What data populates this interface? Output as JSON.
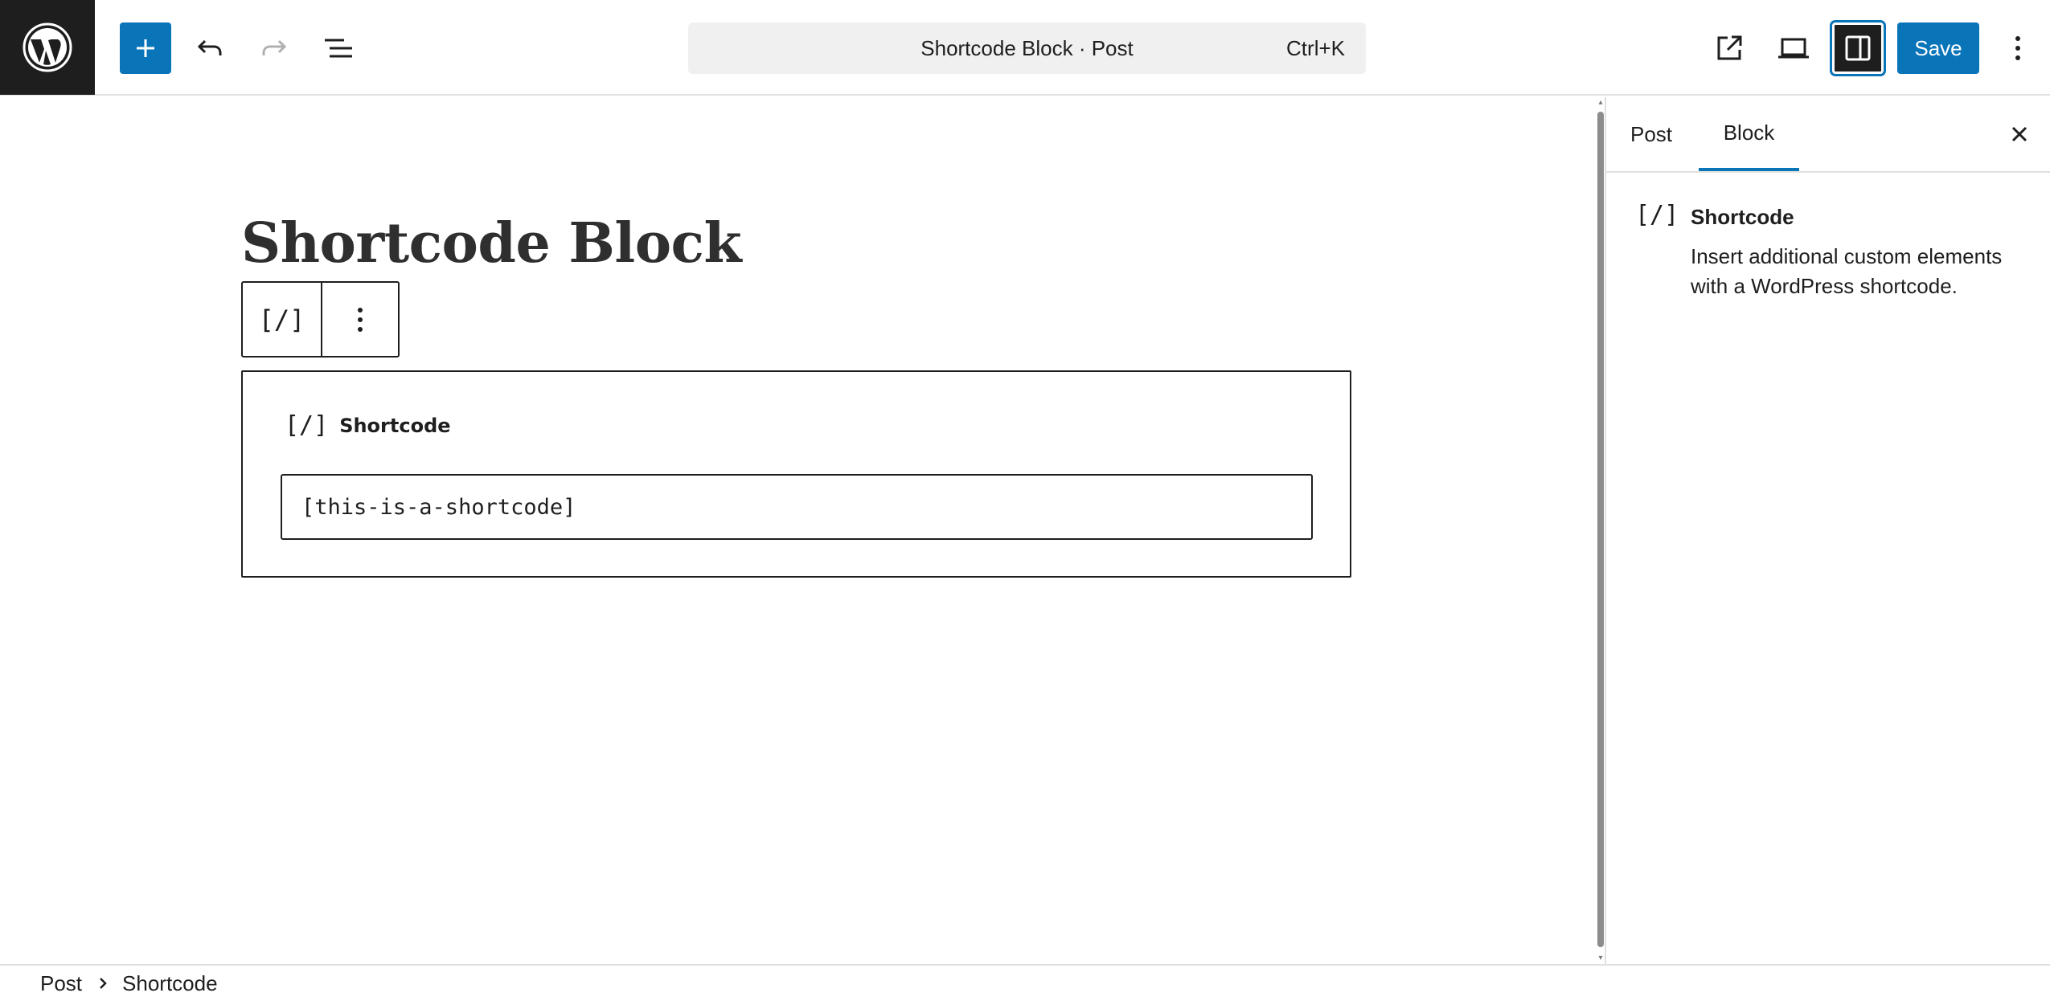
{
  "header": {
    "logo_icon": "wordpress-logo-icon",
    "inserter_icon": "plus-icon",
    "undo_icon": "undo-icon",
    "redo_icon": "redo-icon",
    "document_overview_icon": "list-view-icon",
    "command_bar": {
      "title": "Shortcode Block · Post",
      "shortcut": "Ctrl+K"
    },
    "view_post_icon": "external-link-icon",
    "preview_icon": "laptop-icon",
    "settings_icon": "sidebar-toggle-icon",
    "save_label": "Save",
    "options_icon": "vertical-ellipsis-icon"
  },
  "editor": {
    "post_title": "Shortcode Block",
    "block_toolbar": {
      "block_type_glyph": "[/]",
      "more_options_icon": "vertical-ellipsis-icon"
    },
    "shortcode_block": {
      "glyph": "[/]",
      "label": "Shortcode",
      "value": "[this-is-a-shortcode]"
    }
  },
  "sidebar": {
    "tabs": [
      {
        "label": "Post",
        "active": false
      },
      {
        "label": "Block",
        "active": true
      }
    ],
    "close_icon": "close-icon",
    "block_card": {
      "glyph": "[/]",
      "title": "Shortcode",
      "description": "Insert additional custom elements with a WordPress shortcode."
    }
  },
  "footer": {
    "breadcrumbs": [
      "Post",
      "Shortcode"
    ],
    "separator_icon": "chevron-right-icon"
  },
  "colors": {
    "accent": "#0a74b9",
    "dark": "#1e1e1e",
    "border": "#e0e0e0",
    "command_bar_bg": "#f0f0f0"
  }
}
